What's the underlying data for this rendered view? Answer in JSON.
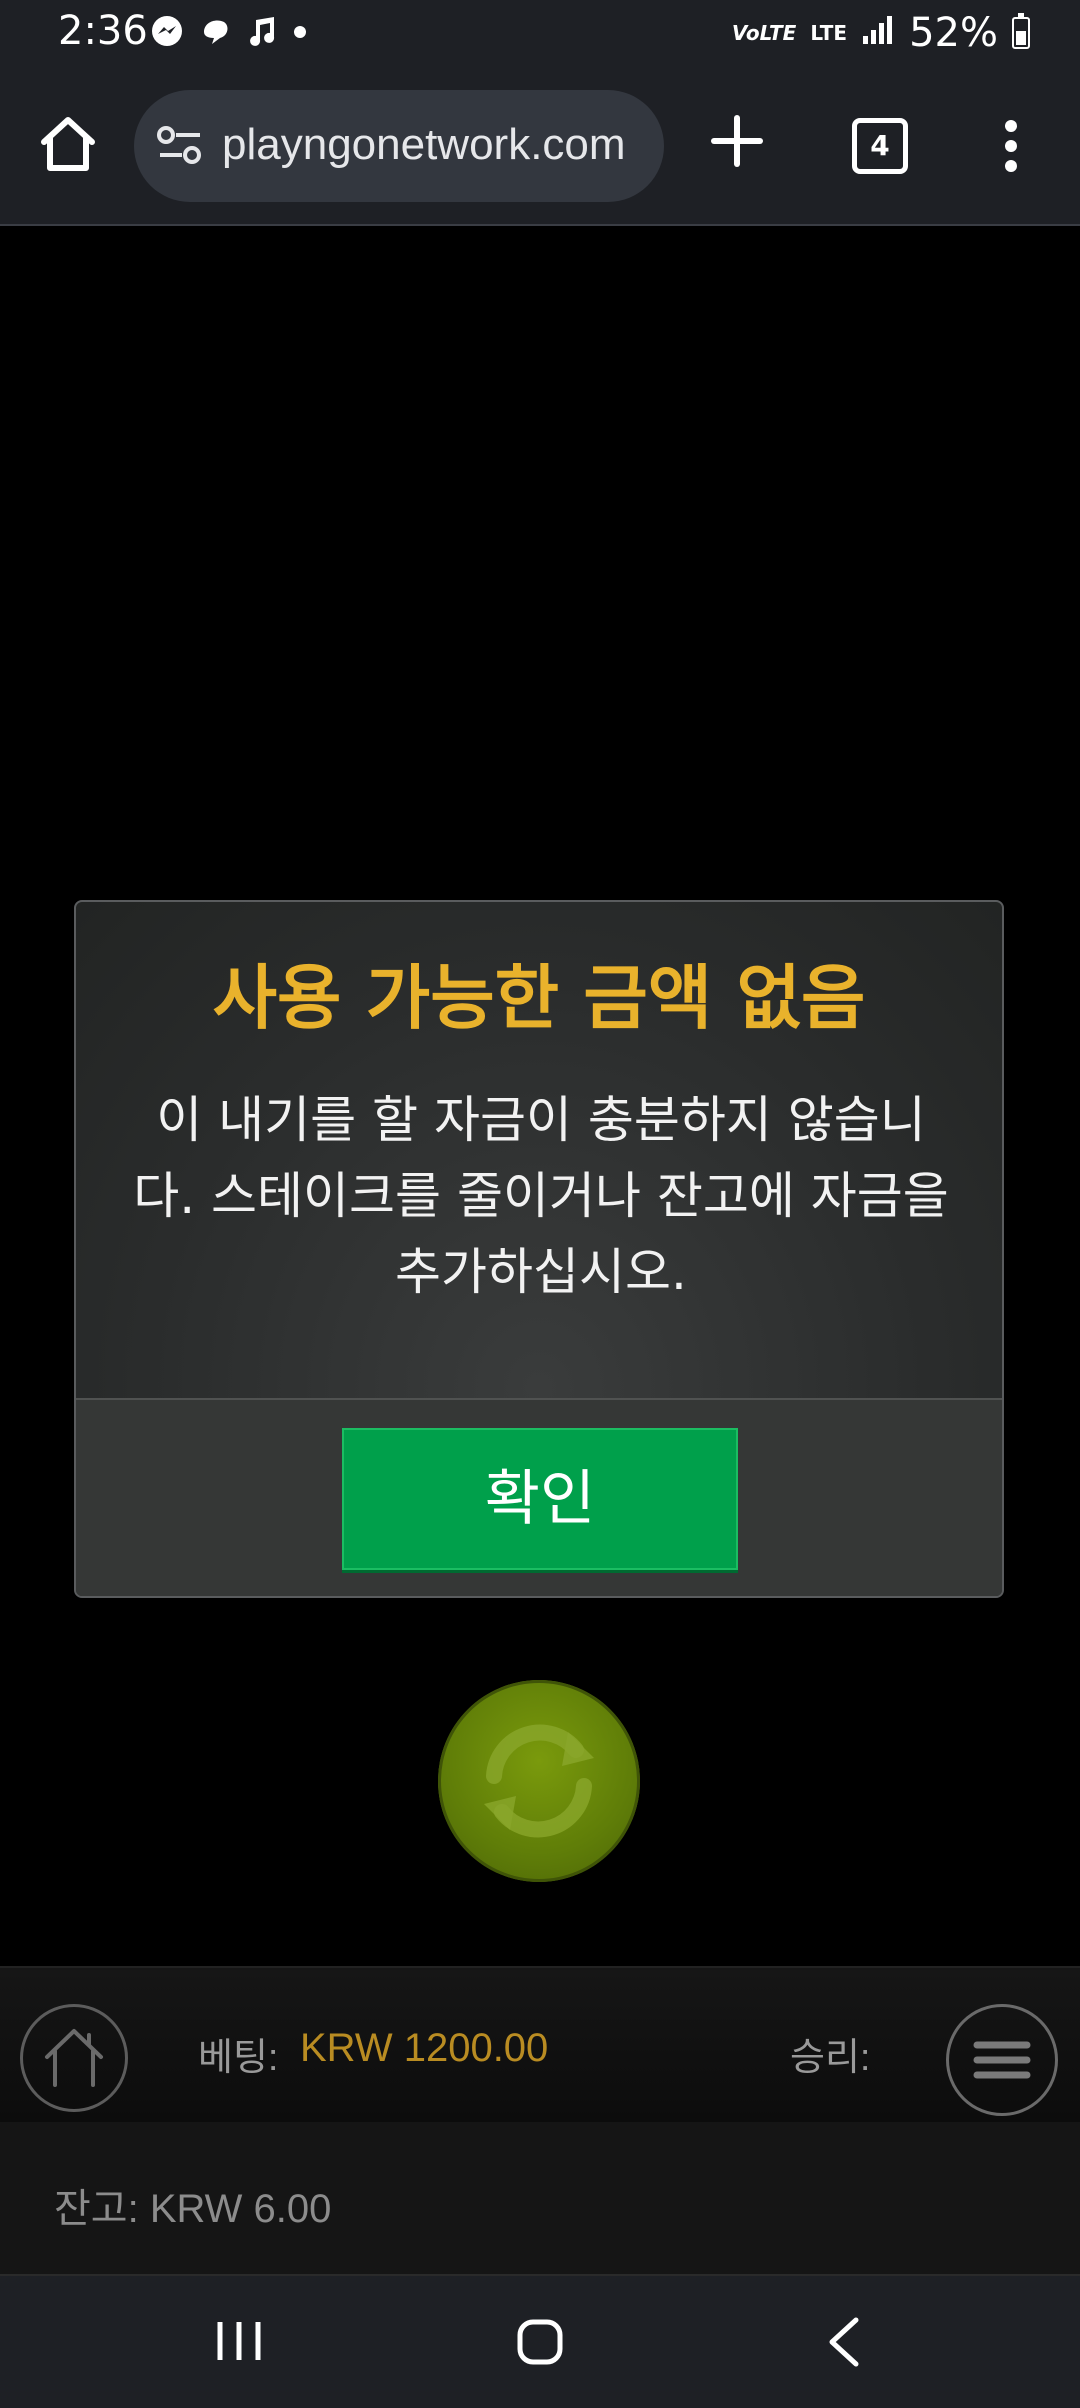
{
  "status_bar": {
    "time": "2:36",
    "volte": "VoLTE",
    "lte": "LTE",
    "battery": "52%",
    "icons": [
      "messenger-icon",
      "threads-icon",
      "music-note-icon",
      "dot-icon",
      "signal-icon",
      "battery-icon"
    ]
  },
  "browser": {
    "url": "playngonetwork.com",
    "tab_count": "4"
  },
  "dialog": {
    "title": "사용 가능한 금액 없음",
    "message_line1": "이 내기를 할 자금이 충분하지 않습니",
    "message_line2": "다. 스테이크를 줄이거나 잔고에 자금을",
    "message_line3": "추가하십시오.",
    "ok_label": "확인"
  },
  "game_bar": {
    "bet_label": "베팅:",
    "bet_value": "KRW 1200.00",
    "win_label": "승리:"
  },
  "balance": {
    "text": "잔고: KRW 6.00"
  },
  "colors": {
    "title": "#e9b22c",
    "ok_button": "#00a04b",
    "spin_button": "#6a8a0a",
    "bet_value": "#b98c22"
  }
}
